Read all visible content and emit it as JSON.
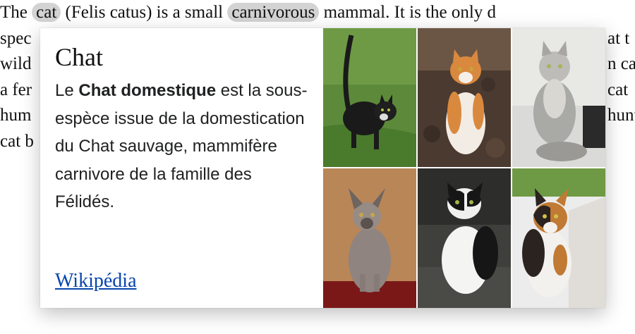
{
  "article": {
    "lines": [
      [
        "The ",
        "cat",
        " (Felis catus) is a small ",
        "carnivorous",
        " mammal. It is the only d"
      ],
      [
        "spec",
        "",
        "",
        "",
        "at t"
      ],
      [
        "wild",
        "",
        "",
        "",
        "n ca"
      ],
      [
        "a fer",
        "",
        "",
        "",
        "cat"
      ],
      [
        "hum",
        "",
        "",
        "",
        "hunt"
      ],
      [
        "cat b",
        "",
        "",
        "",
        ""
      ]
    ],
    "line1": {
      "before": "The ",
      "link1": "cat",
      "middle": " (Felis catus) is a small ",
      "link2": "carnivorous",
      "after": " mammal. It is the only d"
    },
    "left_fragments": [
      "spec",
      "wild",
      "a fer",
      "hum",
      "cat b"
    ],
    "right_fragments": [
      "at t",
      "n ca",
      "cat",
      "hunt"
    ]
  },
  "popup": {
    "title": "Chat",
    "extract_bold": "Chat domestique",
    "extract_prefix": "Le ",
    "extract_rest": " est la sous-espèce issue de la domestication du Chat sauvage, mammifère carnivore de la famille des Félidés.",
    "link_label": "Wikipédia",
    "images": [
      {
        "name": "black-cat-walking-on-grass"
      },
      {
        "name": "orange-white-cat-sitting-on-leaves"
      },
      {
        "name": "grey-longhair-cat-sitting"
      },
      {
        "name": "siamese-cat-sitting"
      },
      {
        "name": "black-white-cat-sitting"
      },
      {
        "name": "calico-cat-sitting"
      }
    ]
  }
}
